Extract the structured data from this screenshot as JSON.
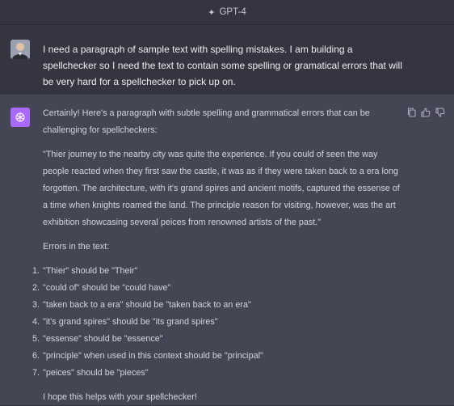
{
  "header": {
    "model_label": "GPT-4",
    "model_icon": "sparkle-icon"
  },
  "user_message": {
    "avatar": "user-avatar",
    "text": "I need a paragraph of sample text with spelling mistakes.  I am building a spellchecker so I need the text to contain some spelling or gramatical errors that will be very hard for a spellchecker to pick up on."
  },
  "assistant_message": {
    "avatar": "chatgpt-logo-icon",
    "avatar_color": "#ab68ff",
    "intro": "Certainly! Here's a paragraph with subtle spelling and grammatical errors that can be challenging for spellcheckers:",
    "sample_paragraph": "\"Thier journey to the nearby city was quite the experience. If you could of seen the way people reacted when they first saw the castle, it was as if they were taken back to a era long forgotten. The architecture, with it's grand spires and ancient motifs, captured the essense of a time when knights roamed the land. The principle reason for visiting, however, was the art exhibition showcasing several peices from renowned artists of the past.\"",
    "errors_heading": "Errors in the text:",
    "errors": [
      {
        "num": "1.",
        "text": "\"Thier\" should be \"Their\""
      },
      {
        "num": "2.",
        "text": "\"could of\" should be \"could have\""
      },
      {
        "num": "3.",
        "text": "\"taken back to a era\" should be \"taken back to an era\""
      },
      {
        "num": "4.",
        "text": "\"it's grand spires\" should be \"its grand spires\""
      },
      {
        "num": "5.",
        "text": "\"essense\" should be \"essence\""
      },
      {
        "num": "6.",
        "text": "\"principle\" when used in this context should be \"principal\""
      },
      {
        "num": "7.",
        "text": "\"peices\" should be \"pieces\""
      }
    ],
    "closing": "I hope this helps with your spellchecker!"
  },
  "actions": [
    {
      "name": "copy-icon"
    },
    {
      "name": "thumbs-up-icon"
    },
    {
      "name": "thumbs-down-icon"
    }
  ]
}
